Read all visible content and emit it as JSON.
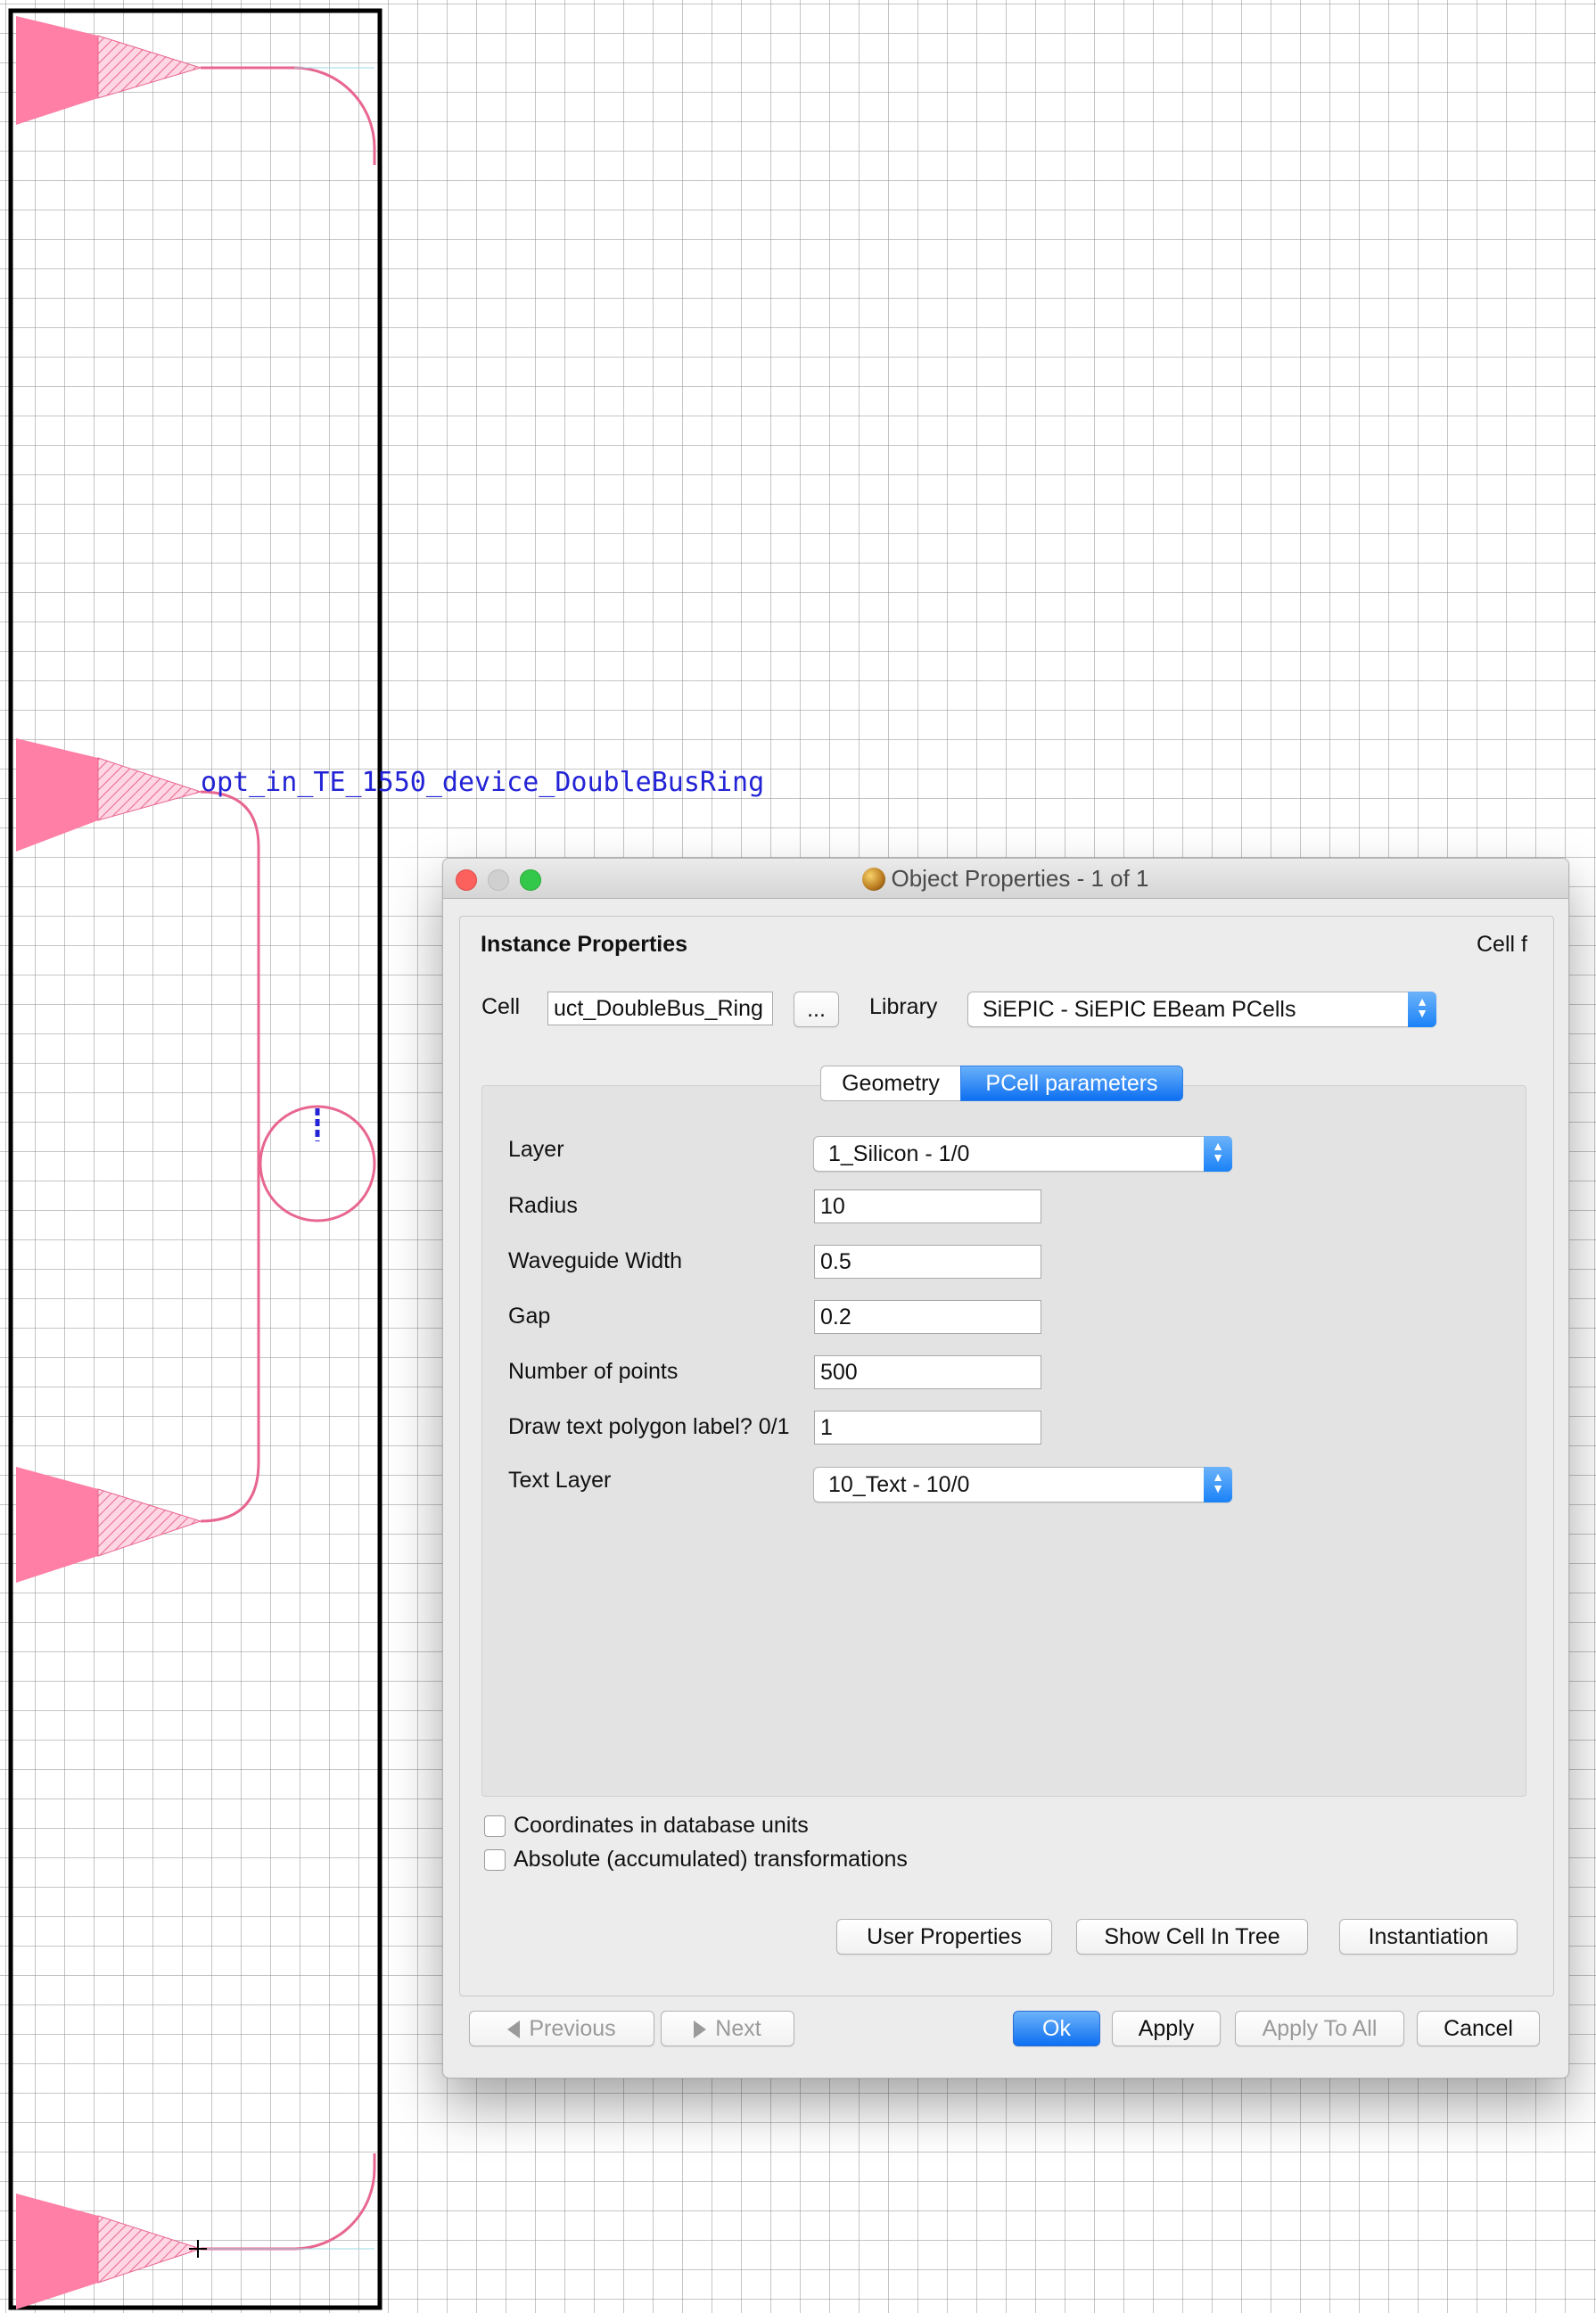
{
  "layout": {
    "label": "opt_in_TE_1550_device_DoubleBusRing",
    "colors": {
      "waveguide": "#e8668f",
      "grating": "#ff7fa6",
      "label": "#2323d6",
      "cellbox": "#000000"
    }
  },
  "dialog": {
    "title": "Object Properties - 1 of 1",
    "section_title": "Instance Properties",
    "cell_frame_label": "Cell f",
    "cell_label": "Cell",
    "cell_value": "uct_DoubleBus_Ring",
    "browse_label": "...",
    "library_label": "Library",
    "library_value": "SiEPIC - SiEPIC EBeam PCells",
    "tabs": [
      {
        "label": "Geometry",
        "active": false
      },
      {
        "label": "PCell parameters",
        "active": true
      }
    ],
    "params": {
      "layer_label": "Layer",
      "layer_value": "1_Silicon - 1/0",
      "radius_label": "Radius",
      "radius_value": "10",
      "wg_width_label": "Waveguide Width",
      "wg_width_value": "0.5",
      "gap_label": "Gap",
      "gap_value": "0.2",
      "npoints_label": "Number of points",
      "npoints_value": "500",
      "textlabel_label": "Draw text polygon label? 0/1",
      "textlabel_value": "1",
      "textlayer_label": "Text Layer",
      "textlayer_value": "10_Text - 10/0"
    },
    "checkboxes": {
      "dbu_label": "Coordinates in database units",
      "dbu_checked": false,
      "abs_label": "Absolute (accumulated) transformations",
      "abs_checked": false
    },
    "buttons": {
      "user_properties": "User Properties",
      "show_cell": "Show Cell In Tree",
      "instantiation": "Instantiation",
      "previous": "Previous",
      "next": "Next",
      "ok": "Ok",
      "apply": "Apply",
      "apply_all": "Apply To All",
      "cancel": "Cancel"
    }
  }
}
